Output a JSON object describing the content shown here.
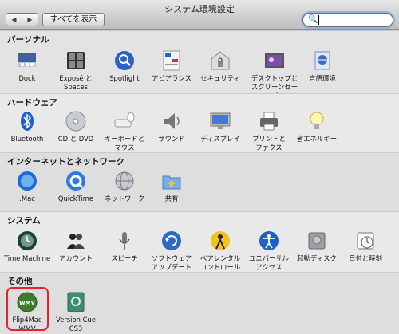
{
  "window": {
    "title": "システム環境設定"
  },
  "toolbar": {
    "back_glyph": "◀",
    "forward_glyph": "▶",
    "show_all_label": "すべてを表示",
    "search_icon": "search-icon",
    "search_value": ""
  },
  "sections": {
    "personal": {
      "title": "パーソナル",
      "items": [
        {
          "label": "Dock",
          "icon": "dock-icon"
        },
        {
          "label": "Exposé と\nSpaces",
          "icon": "expose-spaces-icon"
        },
        {
          "label": "Spotlight",
          "icon": "spotlight-icon"
        },
        {
          "label": "アピアランス",
          "icon": "appearance-icon"
        },
        {
          "label": "セキュリティ",
          "icon": "security-icon"
        },
        {
          "label": "デスクトップと\nスクリーンセーバ",
          "icon": "desktop-screensaver-icon"
        },
        {
          "label": "言語環境",
          "icon": "international-icon"
        }
      ]
    },
    "hardware": {
      "title": "ハードウェア",
      "items": [
        {
          "label": "Bluetooth",
          "icon": "bluetooth-icon"
        },
        {
          "label": "CD と DVD",
          "icon": "cd-dvd-icon"
        },
        {
          "label": "キーボードと\nマウス",
          "icon": "keyboard-mouse-icon"
        },
        {
          "label": "サウンド",
          "icon": "sound-icon"
        },
        {
          "label": "ディスプレイ",
          "icon": "displays-icon"
        },
        {
          "label": "プリントと\nファクス",
          "icon": "print-fax-icon"
        },
        {
          "label": "省エネルギー",
          "icon": "energy-saver-icon"
        }
      ]
    },
    "internet": {
      "title": "インターネットとネットワーク",
      "items": [
        {
          "label": ".Mac",
          "icon": "dotmac-icon"
        },
        {
          "label": "QuickTime",
          "icon": "quicktime-icon"
        },
        {
          "label": "ネットワーク",
          "icon": "network-icon"
        },
        {
          "label": "共有",
          "icon": "sharing-icon"
        }
      ]
    },
    "system": {
      "title": "システム",
      "items": [
        {
          "label": "Time Machine",
          "icon": "time-machine-icon"
        },
        {
          "label": "アカウント",
          "icon": "accounts-icon"
        },
        {
          "label": "スピーチ",
          "icon": "speech-icon"
        },
        {
          "label": "ソフトウェア\nアップデート",
          "icon": "software-update-icon"
        },
        {
          "label": "ペアレンタル\nコントロール",
          "icon": "parental-controls-icon"
        },
        {
          "label": "ユニバーサル\nアクセス",
          "icon": "universal-access-icon"
        },
        {
          "label": "起動ディスク",
          "icon": "startup-disk-icon"
        },
        {
          "label": "日付と時刻",
          "icon": "date-time-icon"
        }
      ]
    },
    "other": {
      "title": "その他",
      "items": [
        {
          "label": "Flip4Mac\nWMV",
          "icon": "flip4mac-wmv-icon",
          "icon_text": "WMV"
        },
        {
          "label": "Version Cue\nCS3",
          "icon": "version-cue-icon"
        }
      ]
    }
  },
  "colors": {
    "highlight": "#e0262a",
    "section_bg_alt": "#dcdcdc",
    "section_bg": "#e8e8e8"
  }
}
